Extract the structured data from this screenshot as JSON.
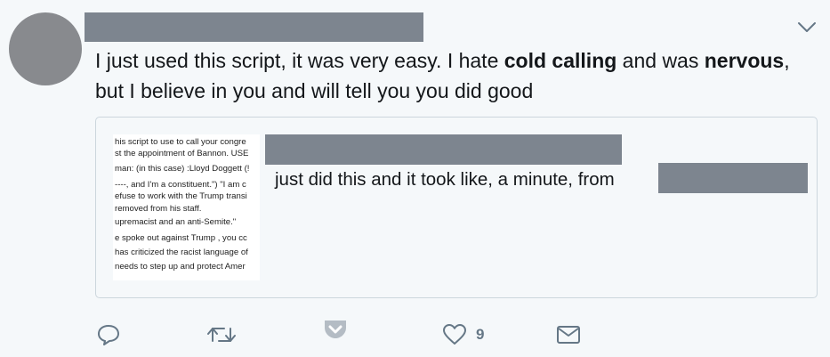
{
  "tweet": {
    "text_part1": "I just used this script, it was very easy. I hate ",
    "text_bold1": "cold calling",
    "text_part2": " and was ",
    "text_bold2": "nervous",
    "text_part3": ", but I believe in you and will tell you you did good"
  },
  "card": {
    "description": "just did this and it took like, a minute, from",
    "thumbnail_lines": [
      "his script to use to call your congre",
      "st the appointment of Bannon. USE",
      "man: (in this case) :Lloyd Doggett (!",
      "----, and I'm a constituent.\") \"I am c",
      "efuse to work with the Trump transi",
      "removed from his staff.",
      "upremacist and an anti-Semite.\"",
      "e spoke out against Trump , you cc",
      "has criticized the racist language of",
      "needs to step up and protect Amer"
    ]
  },
  "actions": {
    "like_count": "9"
  },
  "colors": {
    "background": "#f5f8fa",
    "icon": "#657786",
    "redaction": "#7d858f"
  },
  "icons": [
    "reply-icon",
    "retweet-icon",
    "pocket-icon",
    "heart-icon",
    "mail-icon",
    "chevron-down-icon"
  ]
}
